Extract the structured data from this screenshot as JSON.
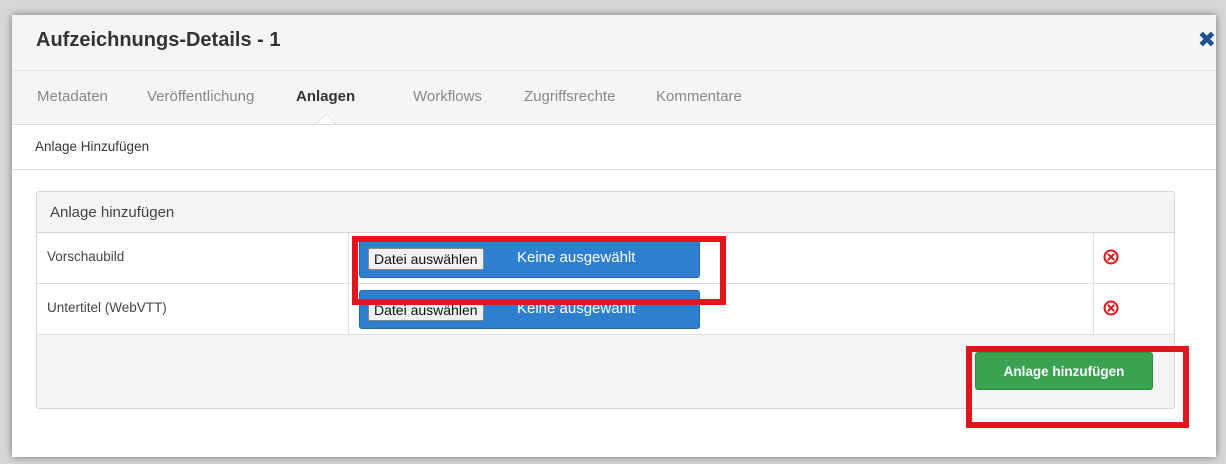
{
  "dialog": {
    "title": "Aufzeichnungs-Details - 1",
    "close_label": "✖"
  },
  "tabs": [
    {
      "label": "Metadaten"
    },
    {
      "label": "Veröffentlichung"
    },
    {
      "label": "Anlagen"
    },
    {
      "label": "Workflows"
    },
    {
      "label": "Zugriffsrechte"
    },
    {
      "label": "Kommentare"
    }
  ],
  "active_tab": "Anlagen",
  "subnav": {
    "link": "Anlage Hinzufügen"
  },
  "panel": {
    "title": "Anlage hinzufügen",
    "rows": [
      {
        "label": "Vorschaubild",
        "choose": "Datei auswählen",
        "status": "Keine ausgewählt",
        "remove_icon": "remove-circle-icon"
      },
      {
        "label": "Untertitel (WebVTT)",
        "choose": "Datei auswählen",
        "status": "Keine ausgewählt",
        "remove_icon": "remove-circle-icon"
      }
    ],
    "submit_label": "Anlage hinzufügen"
  },
  "colors": {
    "file_button": "#2f7fd0",
    "submit_button": "#3aa250",
    "remove_icon": "#e3141b",
    "highlight": "#e3141b",
    "close_icon": "#1f4f8f"
  }
}
